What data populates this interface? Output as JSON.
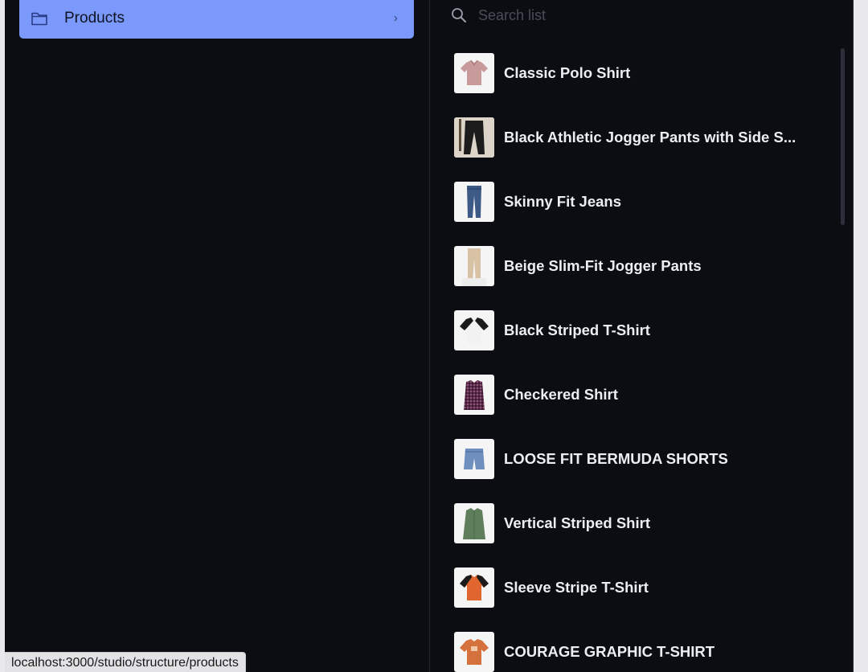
{
  "sidebar": {
    "items": [
      {
        "label": "Products",
        "icon": "folder-icon",
        "chevron": "›"
      }
    ]
  },
  "search": {
    "placeholder": "Search list",
    "value": ""
  },
  "products": [
    {
      "title": "Classic Polo Shirt",
      "thumbnail": "polo-shirt"
    },
    {
      "title": "Black Athletic Jogger Pants with Side S...",
      "thumbnail": "jogger-pants-black"
    },
    {
      "title": "Skinny Fit Jeans",
      "thumbnail": "jeans"
    },
    {
      "title": "Beige Slim-Fit Jogger Pants",
      "thumbnail": "jogger-pants-beige"
    },
    {
      "title": "Black Striped T-Shirt",
      "thumbnail": "raglan-tshirt-black"
    },
    {
      "title": "Checkered Shirt",
      "thumbnail": "checkered-shirt"
    },
    {
      "title": "LOOSE FIT BERMUDA SHORTS",
      "thumbnail": "denim-shorts"
    },
    {
      "title": "Vertical Striped Shirt",
      "thumbnail": "green-shirt"
    },
    {
      "title": "Sleeve Stripe T-Shirt",
      "thumbnail": "orange-tshirt"
    },
    {
      "title": "COURAGE GRAPHIC T-SHIRT",
      "thumbnail": "graphic-tshirt-orange"
    }
  ],
  "status_bar": {
    "url": "localhost:3000/studio/structure/products"
  },
  "colors": {
    "background": "#0c0d13",
    "selected": "#7b99fb",
    "text": "#eceef3",
    "muted": "#4a4d59"
  }
}
